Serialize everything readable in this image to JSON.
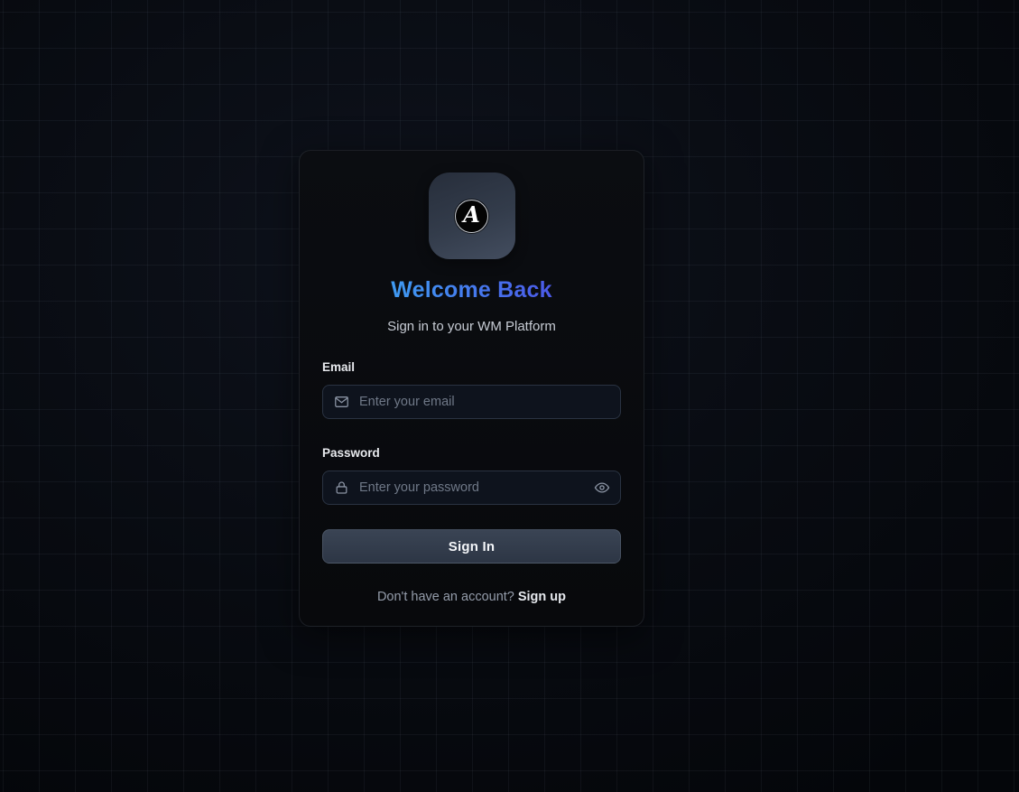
{
  "page": {
    "title": "Welcome Back",
    "subtitle": "Sign in to your WM Platform"
  },
  "logo": {
    "letter": "A"
  },
  "form": {
    "email": {
      "label": "Email",
      "placeholder": "Enter your email",
      "value": ""
    },
    "password": {
      "label": "Password",
      "placeholder": "Enter your password",
      "value": ""
    },
    "submit_label": "Sign In"
  },
  "footer": {
    "prompt": "Don't have an account?",
    "link_label": "Sign up"
  },
  "icons": {
    "email_field": "envelope-icon",
    "password_field": "lock-icon",
    "password_toggle": "eye-icon"
  },
  "colors": {
    "background_base": "#05070b",
    "grid_line": "rgba(148,163,184,0.07)",
    "card_background": "#0a0c10",
    "card_border": "rgba(148,163,184,0.14)",
    "title_gradient_start": "#3f9bf2",
    "title_gradient_end": "#4b59e8",
    "subtitle_text": "#c7ccd4",
    "label_text": "#e8eaee",
    "input_background": "#0e131d",
    "input_border": "#2a3342",
    "placeholder_text": "#6f7887",
    "icon_gray": "#8a93a3",
    "button_gradient_top": "#3a4454",
    "button_gradient_bottom": "#2d3645",
    "button_text": "#f4f6f9",
    "footer_text": "#949caa",
    "link_text": "#e6e9ee",
    "logo_tile_gradient_start": "#272e3b",
    "logo_tile_gradient_end": "#434d5f"
  }
}
